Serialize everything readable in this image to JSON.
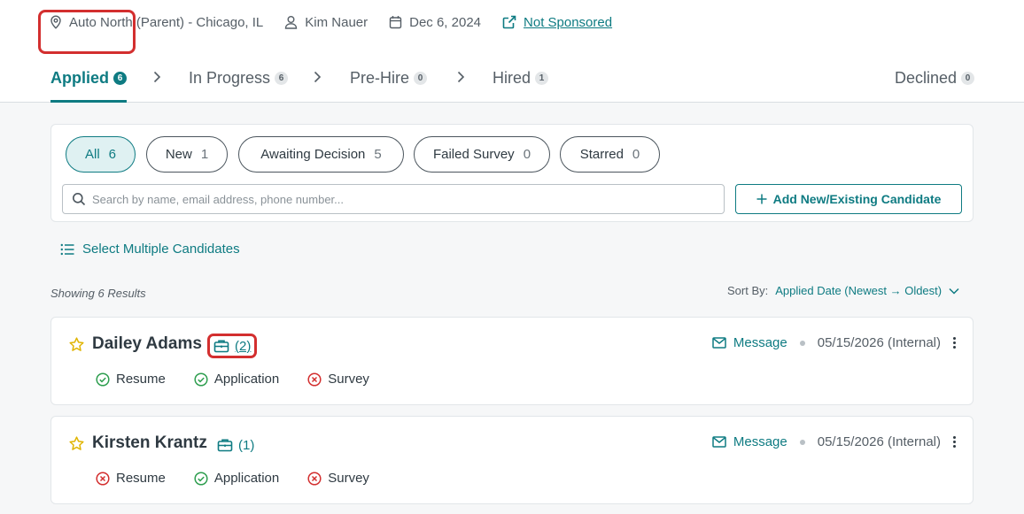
{
  "meta": {
    "location": "Auto North (Parent) - Chicago, IL",
    "user": "Kim Nauer",
    "date": "Dec 6, 2024",
    "sponsorship": "Not Sponsored"
  },
  "tabs": [
    {
      "label": "Applied",
      "count": "6"
    },
    {
      "label": "In Progress",
      "count": "6"
    },
    {
      "label": "Pre-Hire",
      "count": "0"
    },
    {
      "label": "Hired",
      "count": "1"
    },
    {
      "label": "Declined",
      "count": "0"
    }
  ],
  "filters": [
    {
      "label": "All",
      "count": "6"
    },
    {
      "label": "New",
      "count": "1"
    },
    {
      "label": "Awaiting Decision",
      "count": "5"
    },
    {
      "label": "Failed Survey",
      "count": "0"
    },
    {
      "label": "Starred",
      "count": "0"
    }
  ],
  "search": {
    "placeholder": "Search by name, email address, phone number..."
  },
  "add_button": "Add New/Existing Candidate",
  "select_multiple": "Select Multiple Candidates",
  "results_text": "Showing 6 Results",
  "sort": {
    "label": "Sort By:",
    "value": "Applied Date (Newest → Oldest)"
  },
  "candidates": [
    {
      "name": "Dailey Adams",
      "jobs": "(2)",
      "message": "Message",
      "date": "05/15/2026 (Internal)",
      "checks": [
        {
          "label": "Resume",
          "status": "ok"
        },
        {
          "label": "Application",
          "status": "ok"
        },
        {
          "label": "Survey",
          "status": "fail"
        }
      ]
    },
    {
      "name": "Kirsten Krantz",
      "jobs": "(1)",
      "message": "Message",
      "date": "05/15/2026 (Internal)",
      "checks": [
        {
          "label": "Resume",
          "status": "fail"
        },
        {
          "label": "Application",
          "status": "ok"
        },
        {
          "label": "Survey",
          "status": "fail"
        }
      ]
    }
  ],
  "colors": {
    "accent": "#0e7b82",
    "highlight": "#d32f2f",
    "ok": "#2e9e4f",
    "fail": "#d32f2f",
    "star": "#e0b400"
  }
}
